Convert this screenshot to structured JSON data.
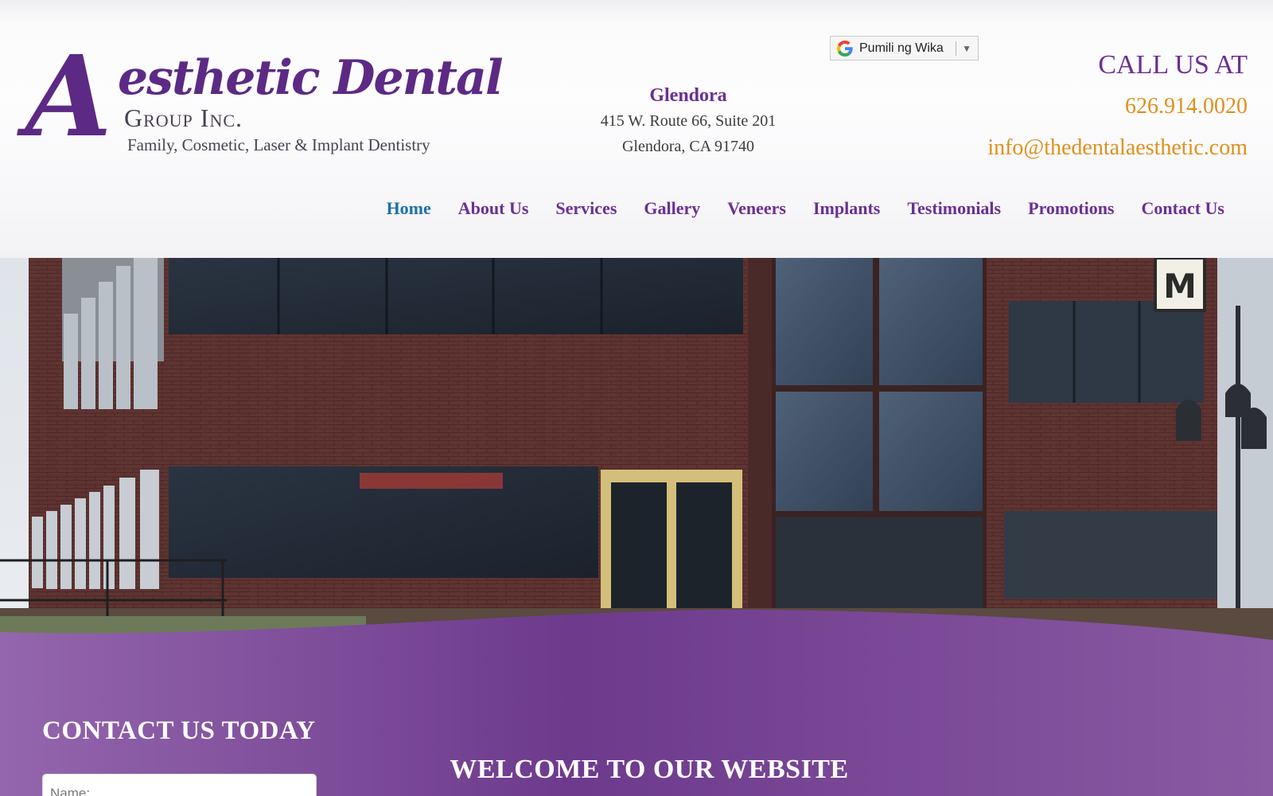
{
  "logo": {
    "big_letter": "A",
    "brand": "esthetic Dental",
    "group": "Group Inc.",
    "tagline": "Family, Cosmetic, Laser & Implant Dentistry"
  },
  "translate": {
    "label": "Pumili ng Wika",
    "arrow": "▼",
    "icon": "google-g-icon"
  },
  "location": {
    "name": "Glendora",
    "address1": "415 W. Route 66, Suite 201",
    "address2": "Glendora, CA 91740"
  },
  "contact": {
    "call_label": "CALL US AT",
    "phone": "626.914.0020",
    "email": "info@thedentalaesthetic.com"
  },
  "nav": {
    "items": [
      {
        "label": "Home",
        "active": true
      },
      {
        "label": "About Us"
      },
      {
        "label": "Services"
      },
      {
        "label": "Gallery"
      },
      {
        "label": "Veneers"
      },
      {
        "label": "Implants"
      },
      {
        "label": "Testimonials"
      },
      {
        "label": "Promotions"
      },
      {
        "label": "Contact Us"
      }
    ]
  },
  "hero": {
    "sign_letter": "M",
    "contact_title": "CONTACT US TODAY",
    "name_placeholder": "Name:",
    "welcome": "WELCOME TO OUR WEBSITE"
  },
  "colors": {
    "brand_purple": "#6b2f94",
    "active_nav": "#1e6fa6",
    "accent_orange": "#e0901c",
    "band_purple": "#7a4a92"
  }
}
